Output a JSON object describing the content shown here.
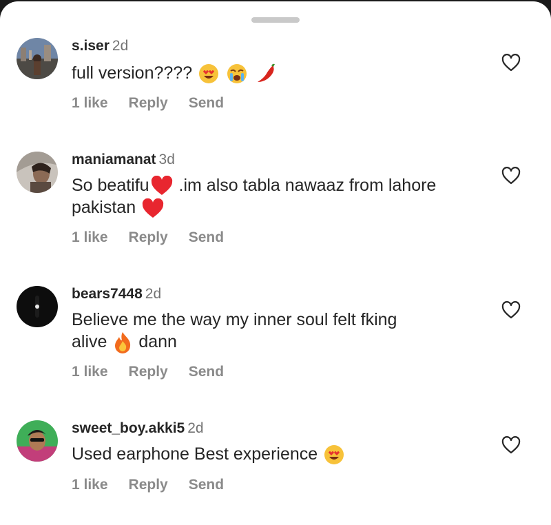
{
  "comments": [
    {
      "username": "s.iser",
      "age": "2d",
      "text_parts": [
        "full version????"
      ],
      "emojis": [
        "heart-eyes-emoji",
        "crying-emoji",
        "chili-emoji"
      ],
      "likes_label": "1 like",
      "reply_label": "Reply",
      "send_label": "Send"
    },
    {
      "username": "maniamanat",
      "age": "3d",
      "text_parts": [
        "So beatifu",
        " .im also tabla nawaaz from lahore",
        "pakistan"
      ],
      "emojis": [
        "red-heart-emoji",
        "red-heart-emoji"
      ],
      "likes_label": "1 like",
      "reply_label": "Reply",
      "send_label": "Send"
    },
    {
      "username": "bears7448",
      "age": "2d",
      "text_parts": [
        "Believe me  the way my inner soul felt fking",
        "alive",
        " dann"
      ],
      "emojis": [
        "fire-emoji"
      ],
      "likes_label": "1 like",
      "reply_label": "Reply",
      "send_label": "Send"
    },
    {
      "username": "sweet_boy.akki5",
      "age": "2d",
      "text_parts": [
        "Used earphone Best experience"
      ],
      "emojis": [
        "heart-eyes-emoji"
      ],
      "likes_label": "1 like",
      "reply_label": "Reply",
      "send_label": "Send"
    }
  ],
  "icons": {
    "like": "heart-outline-icon",
    "grabber": "sheet-grabber-handle"
  },
  "colors": {
    "text_primary": "#262626",
    "text_secondary": "#737373",
    "action_text": "#8a8a8a",
    "grabber": "#c9c9c9"
  }
}
